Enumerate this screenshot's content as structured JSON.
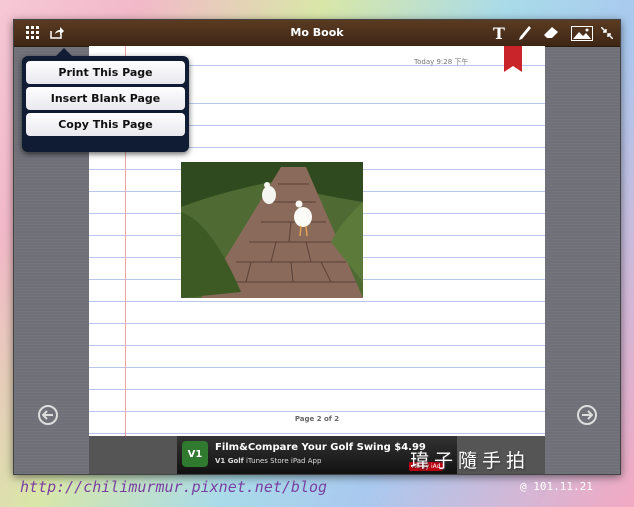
{
  "toolbar": {
    "title": "Mo Book",
    "icons": [
      "grid-icon",
      "share-icon",
      "text-icon",
      "pen-icon",
      "eraser-icon",
      "image-icon",
      "collapse-icon"
    ]
  },
  "page": {
    "date": "Today 9:28 下午",
    "page_number": "Page 2 of 2"
  },
  "menu": {
    "items": [
      "Print This Page",
      "Insert Blank Page",
      "Copy This Page"
    ]
  },
  "ad": {
    "title": "Film&Compare Your Golf Swing $4.99",
    "subtitle_bold": "V1 Golf",
    "subtitle": "iTunes Store iPad App",
    "badge": "Ad by iAd",
    "icon_text": "V1"
  },
  "watermark": {
    "text": "瑋子隨手拍",
    "blog": "http://chilimurmur.pixnet.net/blog",
    "stamp": "@ 101.11.21"
  },
  "colors": {
    "toolbar": "#4b2f1b",
    "ribbon": "#c9242a",
    "menu_bg": "#0f1c33"
  }
}
